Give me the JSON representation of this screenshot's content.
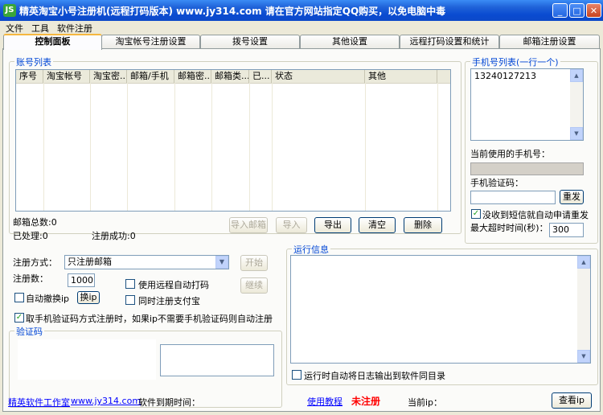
{
  "window": {
    "title": "精英淘宝小号注册机(远程打码版本)   www.jy314.com   请在官方网站指定QQ购买，以免电脑中毒",
    "icon_label": "JS",
    "controls": [
      "minimize-icon",
      "maximize-icon",
      "close-icon"
    ],
    "minimize_glyph": "_",
    "maximize_glyph": "□",
    "close_glyph": "✕"
  },
  "menu": {
    "items": [
      "文件",
      "工具",
      "软件注册"
    ]
  },
  "tabs": [
    {
      "label": "控制面板",
      "active": true
    },
    {
      "label": "淘宝帐号注册设置",
      "active": false
    },
    {
      "label": "拨号设置",
      "active": false
    },
    {
      "label": "其他设置",
      "active": false
    },
    {
      "label": "远程打码设置和统计",
      "active": false
    },
    {
      "label": "邮箱注册设置",
      "active": false
    }
  ],
  "accounts": {
    "group_title": "账号列表",
    "columns": [
      "序号",
      "淘宝帐号",
      "淘宝密...",
      "邮箱/手机",
      "邮箱密...",
      "邮箱类...",
      "已...",
      "状态",
      "其他"
    ],
    "rows": [],
    "total_label": "邮箱总数:0",
    "processed_label": "已处理:0",
    "success_label": "注册成功:0",
    "buttons": {
      "import": "导入邮箱",
      "import2": "导入",
      "export": "导出",
      "clear": "清空",
      "delete": "删除"
    }
  },
  "phones": {
    "group_title": "手机号列表(一行一个)",
    "list_value": "13240127213",
    "current_label": "当前使用的手机号：",
    "current_value": "",
    "code_label": "手机验证码：",
    "code_value": "",
    "resend_button": "重发",
    "auto_resend_label": "没收到短信就自动申请重发",
    "auto_resend_checked": true,
    "timeout_label": "最大超时时间(秒)：",
    "timeout_value": "300"
  },
  "register": {
    "mode_label": "注册方式：",
    "mode_value": "只注册邮箱",
    "count_label": "注册数：",
    "count_value": "1000",
    "start_button": "开始",
    "continue_button": "继续",
    "remote_captcha_label": "使用远程自动打码",
    "remote_captcha_checked": false,
    "auto_switch_ip_label": "自动撤换ip",
    "auto_switch_ip_checked": false,
    "switch_ip_button": "换ip",
    "alipay_label": "同时注册支付宝",
    "alipay_checked": false,
    "phone_code_label": "取手机验证码方式注册时，如果ip不需要手机验证码则自动注册",
    "phone_code_checked": true
  },
  "captcha": {
    "group_title": "验证码",
    "input_value": ""
  },
  "log": {
    "group_title": "运行信息",
    "content": "",
    "auto_output_label": "运行时自动将日志输出到软件同目录",
    "auto_output_checked": false
  },
  "status": {
    "studio_name": "精英软件工作室",
    "studio_url": "www.jy314.com",
    "expire_label": "软件到期时间：",
    "tutorial_link": "使用教程",
    "registration_state": "未注册",
    "current_ip_label": "当前ip：",
    "view_ip_button": "查看ip"
  },
  "colors": {
    "titlebar": "#0a4bd1",
    "group_title": "#0046d5",
    "unregistered": "#ff0000",
    "link": "#0000ff",
    "active_tab_accent": "#f5b73f"
  }
}
